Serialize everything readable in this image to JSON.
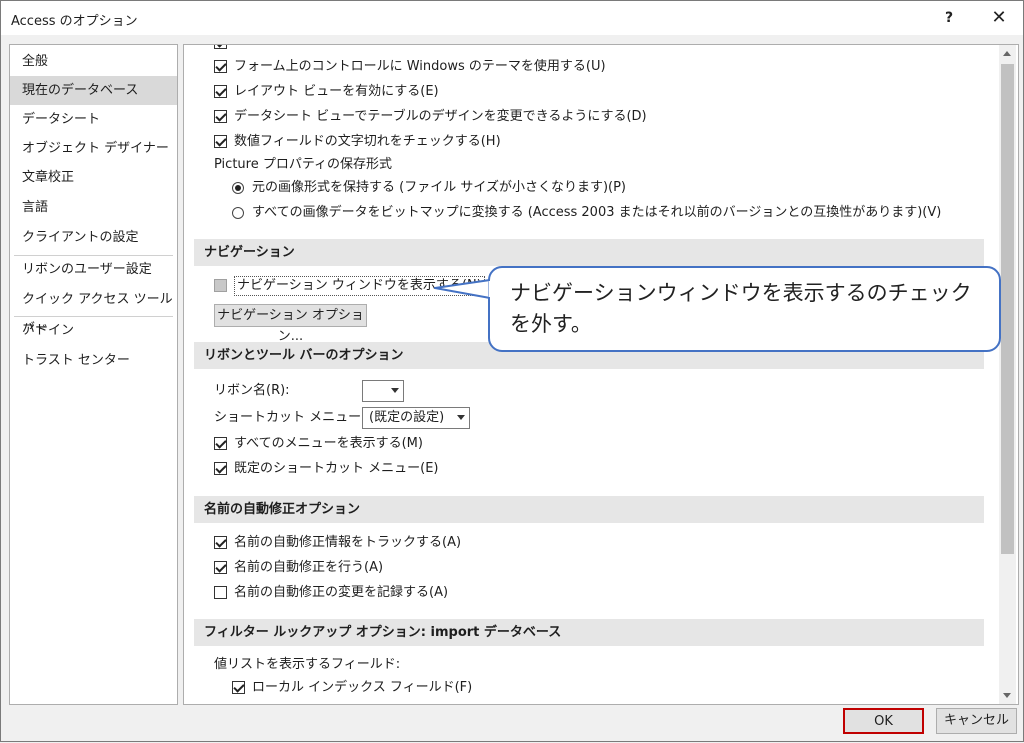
{
  "window": {
    "title": "Access のオプション",
    "help": "?",
    "close": "✕"
  },
  "sidebar": {
    "items": [
      {
        "label": "全般"
      },
      {
        "label": "現在のデータベース",
        "selected": true
      },
      {
        "label": "データシート"
      },
      {
        "label": "オブジェクト デザイナー"
      },
      {
        "label": "文章校正"
      },
      {
        "label": "言語"
      },
      {
        "label": "クライアントの設定"
      },
      {
        "label": "リボンのユーザー設定"
      },
      {
        "label": "クイック アクセス ツール バー"
      },
      {
        "label": "アドイン"
      },
      {
        "label": "トラスト センター"
      }
    ]
  },
  "main": {
    "top_options": [
      {
        "label": "フォーム上のコントロールに Windows のテーマを使用する(U)",
        "checked": true
      },
      {
        "label": "レイアウト ビューを有効にする(E)",
        "checked": true
      },
      {
        "label": "データシート ビューでテーブルのデザインを変更できるようにする(D)",
        "checked": true
      },
      {
        "label": "数値フィールドの文字切れをチェックする(H)",
        "checked": true
      }
    ],
    "picture_label": "Picture プロパティの保存形式",
    "picture_options": [
      {
        "label": "元の画像形式を保持する (ファイル サイズが小さくなります)(P)",
        "selected": true
      },
      {
        "label": "すべての画像データをビットマップに変換する (Access 2003 またはそれ以前のバージョンとの互換性があります)(V)",
        "selected": false
      }
    ],
    "navigation": {
      "header": "ナビゲーション",
      "show_nav": {
        "label": "ナビゲーション ウィンドウを表示する(N)",
        "checked": false
      },
      "options_button": "ナビゲーション オプション..."
    },
    "ribbon": {
      "header": "リボンとツール バーのオプション",
      "ribbon_name_label": "リボン名(R):",
      "ribbon_name_value": "",
      "shortcut_label": "ショートカット メニュー バー:",
      "shortcut_value": "(既定の設定)",
      "options": [
        {
          "label": "すべてのメニューを表示する(M)",
          "checked": true
        },
        {
          "label": "既定のショートカット メニュー(E)",
          "checked": true
        }
      ]
    },
    "autocorrect": {
      "header": "名前の自動修正オプション",
      "options": [
        {
          "label": "名前の自動修正情報をトラックする(A)",
          "checked": true
        },
        {
          "label": "名前の自動修正を行う(A)",
          "checked": true
        },
        {
          "label": "名前の自動修正の変更を記録する(A)",
          "checked": false
        }
      ]
    },
    "filter": {
      "header": "フィルター ルックアップ オプション: import データベース",
      "fields_label": "値リストを表示するフィールド:",
      "local_index": {
        "label": "ローカル インデックス フィールド(F)",
        "checked": true
      }
    }
  },
  "callout": {
    "text": "ナビゲーションウィンドウを表示するのチェックを外す。"
  },
  "footer": {
    "ok": "OK",
    "cancel": "キャンセル"
  },
  "colors": {
    "callout_border": "#4472c4",
    "ok_border": "#c00000",
    "selected_bg": "#d9d9d9"
  }
}
